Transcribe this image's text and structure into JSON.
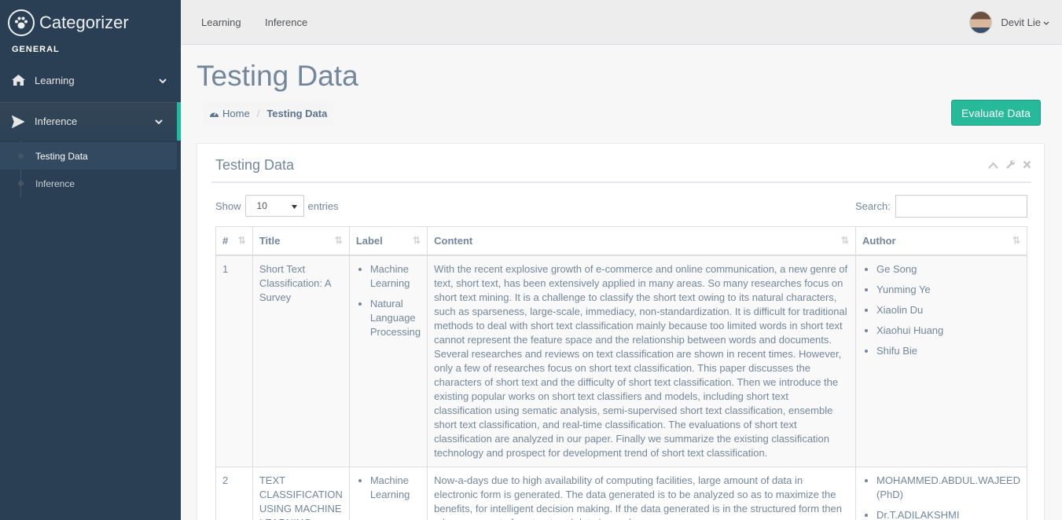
{
  "app": {
    "name": "Categorizer"
  },
  "sidebar": {
    "section": "GENERAL",
    "items": [
      {
        "label": "Learning"
      },
      {
        "label": "Inference"
      }
    ],
    "subitems": [
      {
        "label": "Testing Data"
      },
      {
        "label": "Inference"
      }
    ]
  },
  "topnav": {
    "links": [
      "Learning",
      "Inference"
    ],
    "user": "Devit Lie"
  },
  "page": {
    "title": "Testing Data",
    "breadcrumb": {
      "home": "Home",
      "current": "Testing Data"
    },
    "action_button": "Evaluate Data"
  },
  "panel": {
    "title": "Testing Data",
    "show_label": "Show",
    "entries_value": "10",
    "entries_label": "entries",
    "search_label": "Search:"
  },
  "table": {
    "headers": [
      "#",
      "Title",
      "Label",
      "Content",
      "Author"
    ],
    "rows": [
      {
        "num": "1",
        "title": "Short Text Classification: A Survey",
        "labels": [
          "Machine Learning",
          "Natural Language Processing"
        ],
        "content": "With the recent explosive growth of e-commerce and online communication, a new genre of text, short text, has been extensively applied in many areas. So many researches focus on short text mining. It is a challenge to classify the short text owing to its natural characters, such as sparseness, large-scale, immediacy, non-standardization. It is difficult for traditional methods to deal with short text classification mainly because too limited words in short text cannot represent the feature space and the relationship between words and documents. Several researches and reviews on text classification are shown in recent times. However, only a few of researches focus on short text classification. This paper discusses the characters of short text and the difficulty of short text classification. Then we introduce the existing popular works on short text classifiers and models, including short text classification using sematic analysis, semi-supervised short text classification, ensemble short text classification, and real-time classification. The evaluations of short text classification are analyzed in our paper. Finally we summarize the existing classification technology and prospect for development trend of short text classification.",
        "authors": [
          "Ge Song",
          "Yunming Ye",
          "Xiaolin Du",
          "Xiaohui Huang",
          "Shifu Bie"
        ]
      },
      {
        "num": "2",
        "title": "TEXT CLASSIFICATION USING MACHINE LEARNING",
        "labels": [
          "Machine Learning"
        ],
        "content": "Now-a-days due to high availability of computing facilities, large amount of data in electronic form is generated. The data generated is to be analyzed so as to maximize the benefits, for intelligent decision making. If the data generated is in the structured form then a large amount of unstructured data is used.",
        "authors": [
          "MOHAMMED.ABDUL.WAJEED (PhD)",
          "Dr.T.ADILAKSHMI"
        ]
      }
    ]
  },
  "icons": {
    "brand": "paw-icon",
    "learning": "home-icon",
    "inference": "plane-icon",
    "breadcrumb_home": "dashboard-icon",
    "collapse": "chevron-up-icon",
    "settings": "wrench-icon",
    "close": "close-icon"
  }
}
